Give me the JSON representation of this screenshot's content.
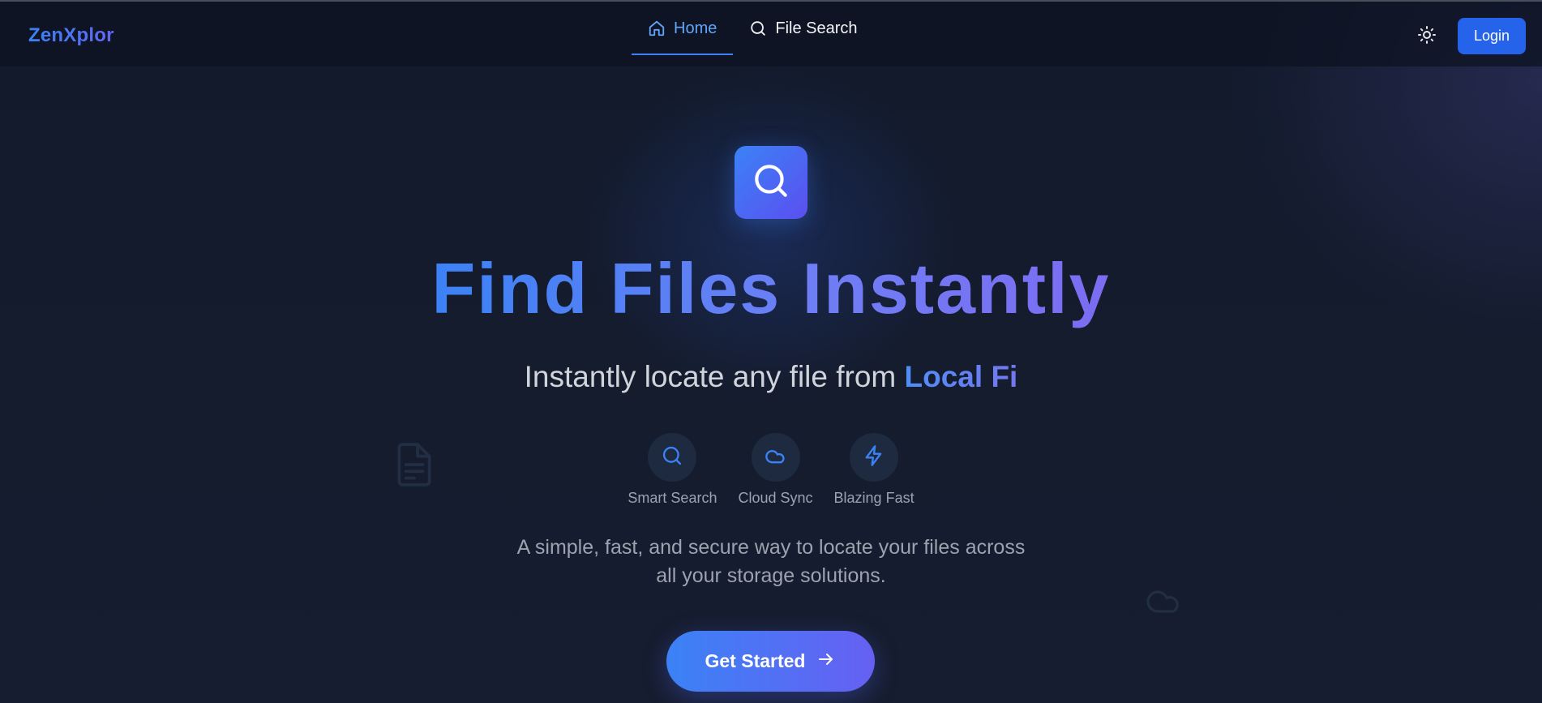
{
  "app": {
    "logo": "ZenXplor"
  },
  "nav": {
    "items": [
      {
        "label": "Home",
        "icon": "home-icon",
        "active": true
      },
      {
        "label": "File Search",
        "icon": "search-icon",
        "active": false
      }
    ]
  },
  "header": {
    "theme_toggle_icon": "sun-icon",
    "login_label": "Login"
  },
  "hero": {
    "icon": "search-icon",
    "title": "Find Files Instantly",
    "subtitle_prefix": "Instantly locate any file from ",
    "subtitle_highlight": "Local Fi",
    "features": [
      {
        "label": "Smart Search",
        "icon": "search-icon"
      },
      {
        "label": "Cloud Sync",
        "icon": "cloud-icon"
      },
      {
        "label": "Blazing Fast",
        "icon": "lightning-icon"
      }
    ],
    "description_line1": "A simple, fast, and secure way to locate your files across",
    "description_line2": "all your storage solutions.",
    "cta_label": "Get Started",
    "cta_icon": "arrow-right-icon"
  },
  "colors": {
    "accent": "#3b82f6",
    "accent_secondary": "#6366f1",
    "background": "#141b2d",
    "login_button": "#2563eb"
  }
}
